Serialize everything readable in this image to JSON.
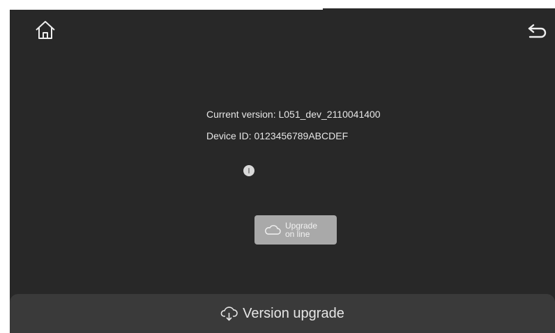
{
  "info": {
    "current_version_label": "Current version:",
    "current_version_value": "L051_dev_2110041400",
    "device_id_label": "Device ID:",
    "device_id_value": "0123456789ABCDEF"
  },
  "upgrade_button": {
    "label": "Upgrade\non line",
    "icon": "cloud-icon"
  },
  "footer": {
    "title": "Version upgrade",
    "icon": "cloud-download-icon"
  },
  "icons": {
    "home": "home-icon",
    "back": "back-arrow-icon",
    "status": "info-dot-icon"
  },
  "colors": {
    "background": "#282828",
    "button": "#a9a9a9",
    "footer": "#3a3a3a",
    "text": "#e6e6e6"
  }
}
